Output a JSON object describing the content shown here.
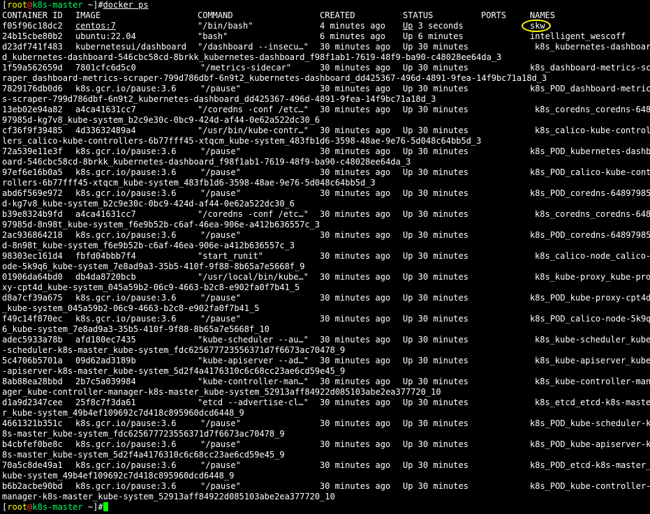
{
  "prompt": {
    "user": "root",
    "host": "k8s-master",
    "dir": "~"
  },
  "command": "docker ps",
  "headers": [
    "CONTAINER ID",
    "IMAGE",
    "COMMAND",
    "CREATED",
    "STATUS",
    "PORTS",
    "NAMES"
  ],
  "top_rows": [
    {
      "id": "f05f96c18dc2",
      "image": "centos:7",
      "command": "\"/bin/bash\"",
      "created": "4 minutes ago",
      "status_up": "Up",
      "status_rest": " 3 seconds",
      "name": "skw"
    },
    {
      "id": "24b15cbe80b2",
      "image": "ubuntu:22.04",
      "command": "\"bash\"",
      "created": "6 minutes ago",
      "status_up": "Up",
      "status_rest": " 6 minutes",
      "name": "intelligent_wescoff"
    }
  ],
  "k8s_rows": [
    {
      "id": "d23df741f483",
      "image": "kubernetesui/dashboard",
      "command": "\"/dashboard --insecu…\"",
      "created": "30 minutes ago",
      "status": "Up 30 minutes",
      "name": "k8s_kubernetes-dashboar",
      "cont": "d_kubernetes-dashboard-546cbc58cd-8brkk_kubernetes-dashboard_f98f1ab1-7619-48f9-ba90-c48028ee64da_3"
    },
    {
      "id": "1f59a562659d",
      "image": "7801cfc6d5c0",
      "command": "\"/metrics-sidecar\"",
      "created": "30 minutes ago",
      "status": "Up 30 minutes",
      "name": "k8s_dashboard-metrics-sc",
      "cont": "raper_dashboard-metrics-scraper-799d786dbf-6n9t2_kubernetes-dashboard_dd425367-496d-4891-9fea-14f9bc71a18d_3"
    },
    {
      "id": "7829176db0d6",
      "image": "k8s.gcr.io/pause:3.6",
      "command": "\"/pause\"",
      "created": "30 minutes ago",
      "status": "Up 30 minutes",
      "name": "k8s_POD_dashboard-metric",
      "cont": "s-scraper-799d786dbf-6n9t2_kubernetes-dashboard_dd425367-496d-4891-9fea-14f9bc71a18d_3"
    },
    {
      "id": "13eb02e94a82",
      "image": "a4ca41631cc7",
      "command": "\"/coredns -conf /etc…\"",
      "created": "30 minutes ago",
      "status": "Up 30 minutes",
      "name": "k8s_coredns_coredns-648",
      "cont": "97985d-kg7v8_kube-system_b2c9e30c-0bc9-424d-af44-0e62a522dc30_6"
    },
    {
      "id": "cf36f9f39485",
      "image": "4d33632489a4",
      "command": "\"/usr/bin/kube-contr…\"",
      "created": "30 minutes ago",
      "status": "Up 30 minutes",
      "name": "k8s_calico-kube-control",
      "cont": "lers_calico-kube-controllers-6b77fff45-xtqcm_kube-system_483fb1d6-3598-48ae-9e76-5d048c64bb5d_3"
    },
    {
      "id": "72a539e11e3f",
      "image": "k8s.gcr.io/pause:3.6",
      "command": "\"/pause\"",
      "created": "30 minutes ago",
      "status": "Up 30 minutes",
      "name": "k8s_POD_kubernetes-dashb",
      "cont": "oard-546cbc58cd-8brkk_kubernetes-dashboard_f98f1ab1-7619-48f9-ba90-c48028ee64da_3"
    },
    {
      "id": "97ef6e16b0a5",
      "image": "k8s.gcr.io/pause:3.6",
      "command": "\"/pause\"",
      "created": "30 minutes ago",
      "status": "Up 30 minutes",
      "name": "k8s_POD_calico-kube-cont",
      "cont": "rollers-6b77fff45-xtqcm_kube-system_483fb1d6-3598-48ae-9e76-5d048c64bb5d_3"
    },
    {
      "id": "abd6f569e972",
      "image": "k8s.gcr.io/pause:3.6",
      "command": "\"/pause\"",
      "created": "30 minutes ago",
      "status": "Up 30 minutes",
      "name": "k8s_POD_coredns-64897985",
      "cont": "d-kg7v8_kube-system_b2c9e30c-0bc9-424d-af44-0e62a522dc30_6"
    },
    {
      "id": "b39e8324b9fd",
      "image": "a4ca41631cc7",
      "command": "\"/coredns -conf /etc…\"",
      "created": "30 minutes ago",
      "status": "Up 30 minutes",
      "name": "k8s_coredns_coredns-648",
      "cont": "97985d-8n98t_kube-system_f6e9b52b-c6af-46ea-906e-a412b636557c_3"
    },
    {
      "id": "2ac936864218",
      "image": "k8s.gcr.io/pause:3.6",
      "command": "\"/pause\"",
      "created": "30 minutes ago",
      "status": "Up 30 minutes",
      "name": "k8s_POD_coredns-64897985",
      "cont": "d-8n98t_kube-system_f6e9b52b-c6af-46ea-906e-a412b636557c_3"
    },
    {
      "id": "98303ec161d4",
      "image": "fbfd04bbb7f4",
      "command": "\"start_runit\"",
      "created": "30 minutes ago",
      "status": "Up 30 minutes",
      "name": "k8s_calico-node_calico-n",
      "cont": "ode-5k9q6_kube-system_7e8ad9a3-35b5-410f-9f88-8b65a7e5668f_9"
    },
    {
      "id": "01906da64bd0",
      "image": "db4da8720bcb",
      "command": "\"/usr/local/bin/kube…\"",
      "created": "30 minutes ago",
      "status": "Up 30 minutes",
      "name": "k8s_kube-proxy_kube-pro",
      "cont": "xy-cpt4d_kube-system_045a59b2-06c9-4663-b2c8-e902fa0f7b41_5"
    },
    {
      "id": "d8a7cf39a675",
      "image": "k8s.gcr.io/pause:3.6",
      "command": "\"/pause\"",
      "created": "30 minutes ago",
      "status": "Up 30 minutes",
      "name": "k8s_POD_kube-proxy-cpt4d",
      "cont": "_kube-system_045a59b2-06c9-4663-b2c8-e902fa0f7b41_5"
    },
    {
      "id": "f49c14f870ec",
      "image": "k8s.gcr.io/pause:3.6",
      "command": "\"/pause\"",
      "created": "30 minutes ago",
      "status": "Up 30 minutes",
      "name": "k8s_POD_calico-node-5k9q",
      "cont": "6_kube-system_7e8ad9a3-35b5-410f-9f88-8b65a7e5668f_10"
    },
    {
      "id": "adec5933a78b",
      "image": "afd180ec7435",
      "command": "\"kube-scheduler --au…\"",
      "created": "30 minutes ago",
      "status": "Up 30 minutes",
      "name": "k8s_kube-scheduler_kube",
      "cont": "-scheduler-k8s-master_kube-system_fdc625677723556371d7f6673ac70478_9"
    },
    {
      "id": "5c4706b5701a",
      "image": "09d62ad3189b",
      "command": "\"kube-apiserver --ad…\"",
      "created": "30 minutes ago",
      "status": "Up 30 minutes",
      "name": "k8s_kube-apiserver_kube",
      "cont": "-apiserver-k8s-master_kube-system_5d2f4a4176310c6c68cc23ae6cd59e45_9"
    },
    {
      "id": "8ab88ea28bbd",
      "image": "2b7c5a039984",
      "command": "\"kube-controller-man…\"",
      "created": "30 minutes ago",
      "status": "Up 30 minutes",
      "name": "k8s_kube-controller-man",
      "cont": "ager_kube-controller-manager-k8s-master_kube-system_52913aff84922d085103abe2ea377720_10"
    },
    {
      "id": "d1a9d2347cee",
      "image": "25f8c7f3da61",
      "command": "\"etcd --advertise-cl…\"",
      "created": "30 minutes ago",
      "status": "Up 30 minutes",
      "name": "k8s_etcd_etcd-k8s-maste",
      "cont": "r_kube-system_49b4ef109692c7d418c895960dcd6448_9"
    },
    {
      "id": "4661321b351c",
      "image": "k8s.gcr.io/pause:3.6",
      "command": "\"/pause\"",
      "created": "30 minutes ago",
      "status": "Up 30 minutes",
      "name": "k8s_POD_kube-scheduler-k",
      "cont": "8s-master_kube-system_fdc625677723556371d7f6673ac70478_9"
    },
    {
      "id": "b4cbfef0be8c",
      "image": "k8s.gcr.io/pause:3.6",
      "command": "\"/pause\"",
      "created": "30 minutes ago",
      "status": "Up 30 minutes",
      "name": "k8s_POD_kube-apiserver-k",
      "cont": "8s-master_kube-system_5d2f4a4176310c6c68cc23ae6cd59e45_9"
    },
    {
      "id": "70a5c8de49a1",
      "image": "k8s.gcr.io/pause:3.6",
      "command": "\"/pause\"",
      "created": "30 minutes ago",
      "status": "Up 30 minutes",
      "name": "k8s_POD_etcd-k8s-master_",
      "cont": "kube-system_49b4ef109692c7d418c895960dcd6448_9"
    },
    {
      "id": "b6b2acbe90bd",
      "image": "k8s.gcr.io/pause:3.6",
      "command": "\"/pause\"",
      "created": "30 minutes ago",
      "status": "Up 30 minutes",
      "name": "k8s_POD_kube-controller-",
      "cont": "manager-k8s-master_kube-system_52913aff84922d085103abe2ea377720_10"
    }
  ],
  "annotation_color": "#ffff00"
}
